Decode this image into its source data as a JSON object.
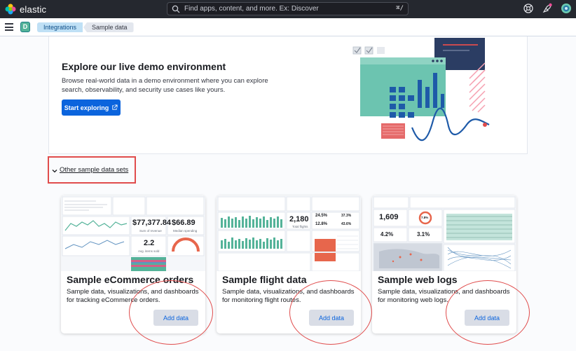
{
  "header": {
    "logo_text": "elastic",
    "search_placeholder": "Find apps, content, and more. Ex: Discover",
    "search_shortcut": "⌘/",
    "icons": [
      "help-icon",
      "newsfeed-icon",
      "user-avatar-icon"
    ]
  },
  "subbar": {
    "space_initial": "D",
    "breadcrumbs": [
      "Integrations",
      "Sample data"
    ]
  },
  "demo": {
    "title": "Explore our live demo environment",
    "description": "Browse real-world data in a demo environment where you can explore search, observability, and security use cases like yours.",
    "button_label": "Start exploring"
  },
  "other_sets": {
    "label": "Other sample data sets"
  },
  "cards": [
    {
      "title": "Sample eCommerce orders",
      "description": "Sample data, visualizations, and dashboards for tracking eCommerce orders.",
      "button": "Add data",
      "preview": {
        "metric1": "$77,377.84",
        "metric1_label": "Sum of revenue",
        "metric2": "$66.89",
        "metric2_label": "Median spending",
        "metric3": "2.2",
        "metric3_label": "Avg. items sold"
      }
    },
    {
      "title": "Sample flight data",
      "description": "Sample data, visualizations, and dashboards for monitoring flight routes.",
      "button": "Add data",
      "preview": {
        "metric1": "2,180",
        "metric1_label": "Total flights",
        "pct1": "24.5%",
        "pct2": "12.8%",
        "pct3": "37.3%",
        "pct4": "43.6%"
      }
    },
    {
      "title": "Sample web logs",
      "description": "Sample data, visualizations, and dashboards for monitoring web logs.",
      "button": "Add data",
      "preview": {
        "metric1": "1,609",
        "pct1": "4.2%",
        "pct2": "3.1%",
        "gauge": "7.8%"
      }
    }
  ],
  "colors": {
    "header_bg": "#25282f",
    "primary": "#0b64dd",
    "annotation": "#e04c4c",
    "teal": "#54b399",
    "navy": "#2b3d63"
  }
}
